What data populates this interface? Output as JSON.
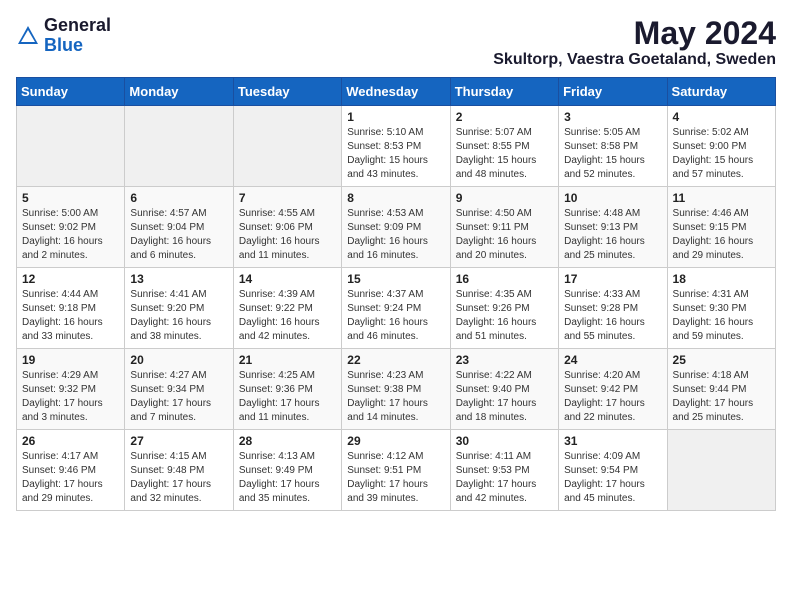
{
  "logo": {
    "general": "General",
    "blue": "Blue"
  },
  "header": {
    "month": "May 2024",
    "location": "Skultorp, Vaestra Goetaland, Sweden"
  },
  "weekdays": [
    "Sunday",
    "Monday",
    "Tuesday",
    "Wednesday",
    "Thursday",
    "Friday",
    "Saturday"
  ],
  "weeks": [
    [
      {
        "day": "",
        "info": ""
      },
      {
        "day": "",
        "info": ""
      },
      {
        "day": "",
        "info": ""
      },
      {
        "day": "1",
        "info": "Sunrise: 5:10 AM\nSunset: 8:53 PM\nDaylight: 15 hours\nand 43 minutes."
      },
      {
        "day": "2",
        "info": "Sunrise: 5:07 AM\nSunset: 8:55 PM\nDaylight: 15 hours\nand 48 minutes."
      },
      {
        "day": "3",
        "info": "Sunrise: 5:05 AM\nSunset: 8:58 PM\nDaylight: 15 hours\nand 52 minutes."
      },
      {
        "day": "4",
        "info": "Sunrise: 5:02 AM\nSunset: 9:00 PM\nDaylight: 15 hours\nand 57 minutes."
      }
    ],
    [
      {
        "day": "5",
        "info": "Sunrise: 5:00 AM\nSunset: 9:02 PM\nDaylight: 16 hours\nand 2 minutes."
      },
      {
        "day": "6",
        "info": "Sunrise: 4:57 AM\nSunset: 9:04 PM\nDaylight: 16 hours\nand 6 minutes."
      },
      {
        "day": "7",
        "info": "Sunrise: 4:55 AM\nSunset: 9:06 PM\nDaylight: 16 hours\nand 11 minutes."
      },
      {
        "day": "8",
        "info": "Sunrise: 4:53 AM\nSunset: 9:09 PM\nDaylight: 16 hours\nand 16 minutes."
      },
      {
        "day": "9",
        "info": "Sunrise: 4:50 AM\nSunset: 9:11 PM\nDaylight: 16 hours\nand 20 minutes."
      },
      {
        "day": "10",
        "info": "Sunrise: 4:48 AM\nSunset: 9:13 PM\nDaylight: 16 hours\nand 25 minutes."
      },
      {
        "day": "11",
        "info": "Sunrise: 4:46 AM\nSunset: 9:15 PM\nDaylight: 16 hours\nand 29 minutes."
      }
    ],
    [
      {
        "day": "12",
        "info": "Sunrise: 4:44 AM\nSunset: 9:18 PM\nDaylight: 16 hours\nand 33 minutes."
      },
      {
        "day": "13",
        "info": "Sunrise: 4:41 AM\nSunset: 9:20 PM\nDaylight: 16 hours\nand 38 minutes."
      },
      {
        "day": "14",
        "info": "Sunrise: 4:39 AM\nSunset: 9:22 PM\nDaylight: 16 hours\nand 42 minutes."
      },
      {
        "day": "15",
        "info": "Sunrise: 4:37 AM\nSunset: 9:24 PM\nDaylight: 16 hours\nand 46 minutes."
      },
      {
        "day": "16",
        "info": "Sunrise: 4:35 AM\nSunset: 9:26 PM\nDaylight: 16 hours\nand 51 minutes."
      },
      {
        "day": "17",
        "info": "Sunrise: 4:33 AM\nSunset: 9:28 PM\nDaylight: 16 hours\nand 55 minutes."
      },
      {
        "day": "18",
        "info": "Sunrise: 4:31 AM\nSunset: 9:30 PM\nDaylight: 16 hours\nand 59 minutes."
      }
    ],
    [
      {
        "day": "19",
        "info": "Sunrise: 4:29 AM\nSunset: 9:32 PM\nDaylight: 17 hours\nand 3 minutes."
      },
      {
        "day": "20",
        "info": "Sunrise: 4:27 AM\nSunset: 9:34 PM\nDaylight: 17 hours\nand 7 minutes."
      },
      {
        "day": "21",
        "info": "Sunrise: 4:25 AM\nSunset: 9:36 PM\nDaylight: 17 hours\nand 11 minutes."
      },
      {
        "day": "22",
        "info": "Sunrise: 4:23 AM\nSunset: 9:38 PM\nDaylight: 17 hours\nand 14 minutes."
      },
      {
        "day": "23",
        "info": "Sunrise: 4:22 AM\nSunset: 9:40 PM\nDaylight: 17 hours\nand 18 minutes."
      },
      {
        "day": "24",
        "info": "Sunrise: 4:20 AM\nSunset: 9:42 PM\nDaylight: 17 hours\nand 22 minutes."
      },
      {
        "day": "25",
        "info": "Sunrise: 4:18 AM\nSunset: 9:44 PM\nDaylight: 17 hours\nand 25 minutes."
      }
    ],
    [
      {
        "day": "26",
        "info": "Sunrise: 4:17 AM\nSunset: 9:46 PM\nDaylight: 17 hours\nand 29 minutes."
      },
      {
        "day": "27",
        "info": "Sunrise: 4:15 AM\nSunset: 9:48 PM\nDaylight: 17 hours\nand 32 minutes."
      },
      {
        "day": "28",
        "info": "Sunrise: 4:13 AM\nSunset: 9:49 PM\nDaylight: 17 hours\nand 35 minutes."
      },
      {
        "day": "29",
        "info": "Sunrise: 4:12 AM\nSunset: 9:51 PM\nDaylight: 17 hours\nand 39 minutes."
      },
      {
        "day": "30",
        "info": "Sunrise: 4:11 AM\nSunset: 9:53 PM\nDaylight: 17 hours\nand 42 minutes."
      },
      {
        "day": "31",
        "info": "Sunrise: 4:09 AM\nSunset: 9:54 PM\nDaylight: 17 hours\nand 45 minutes."
      },
      {
        "day": "",
        "info": ""
      }
    ]
  ]
}
